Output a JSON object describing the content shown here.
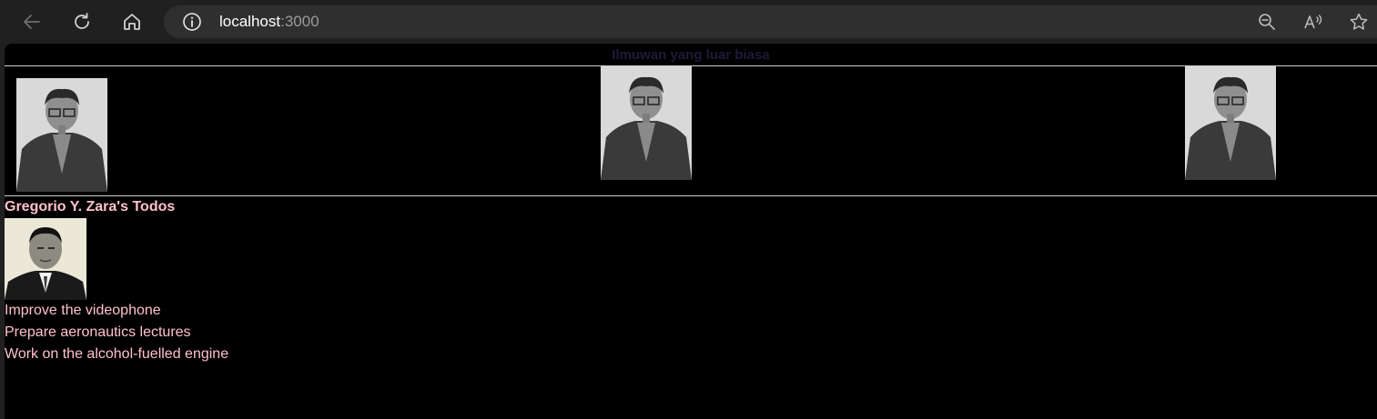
{
  "browser": {
    "url_host": "localhost",
    "url_port": ":3000",
    "icons": [
      "back-arrow-icon",
      "refresh-icon",
      "home-icon",
      "info-icon",
      "zoom-icon",
      "read-aloud-icon",
      "favorite-star-icon"
    ]
  },
  "page": {
    "heading": "Ilmuwan yang luar biasa",
    "todos_title": "Gregorio Y. Zara's Todos",
    "todos": [
      "Improve the videophone",
      "Prepare aeronautics lectures",
      "Work on the alcohol-fuelled engine"
    ],
    "colors": {
      "text": "#ffc0cb",
      "heading": "#1c1c3a",
      "background": "#000000"
    }
  }
}
